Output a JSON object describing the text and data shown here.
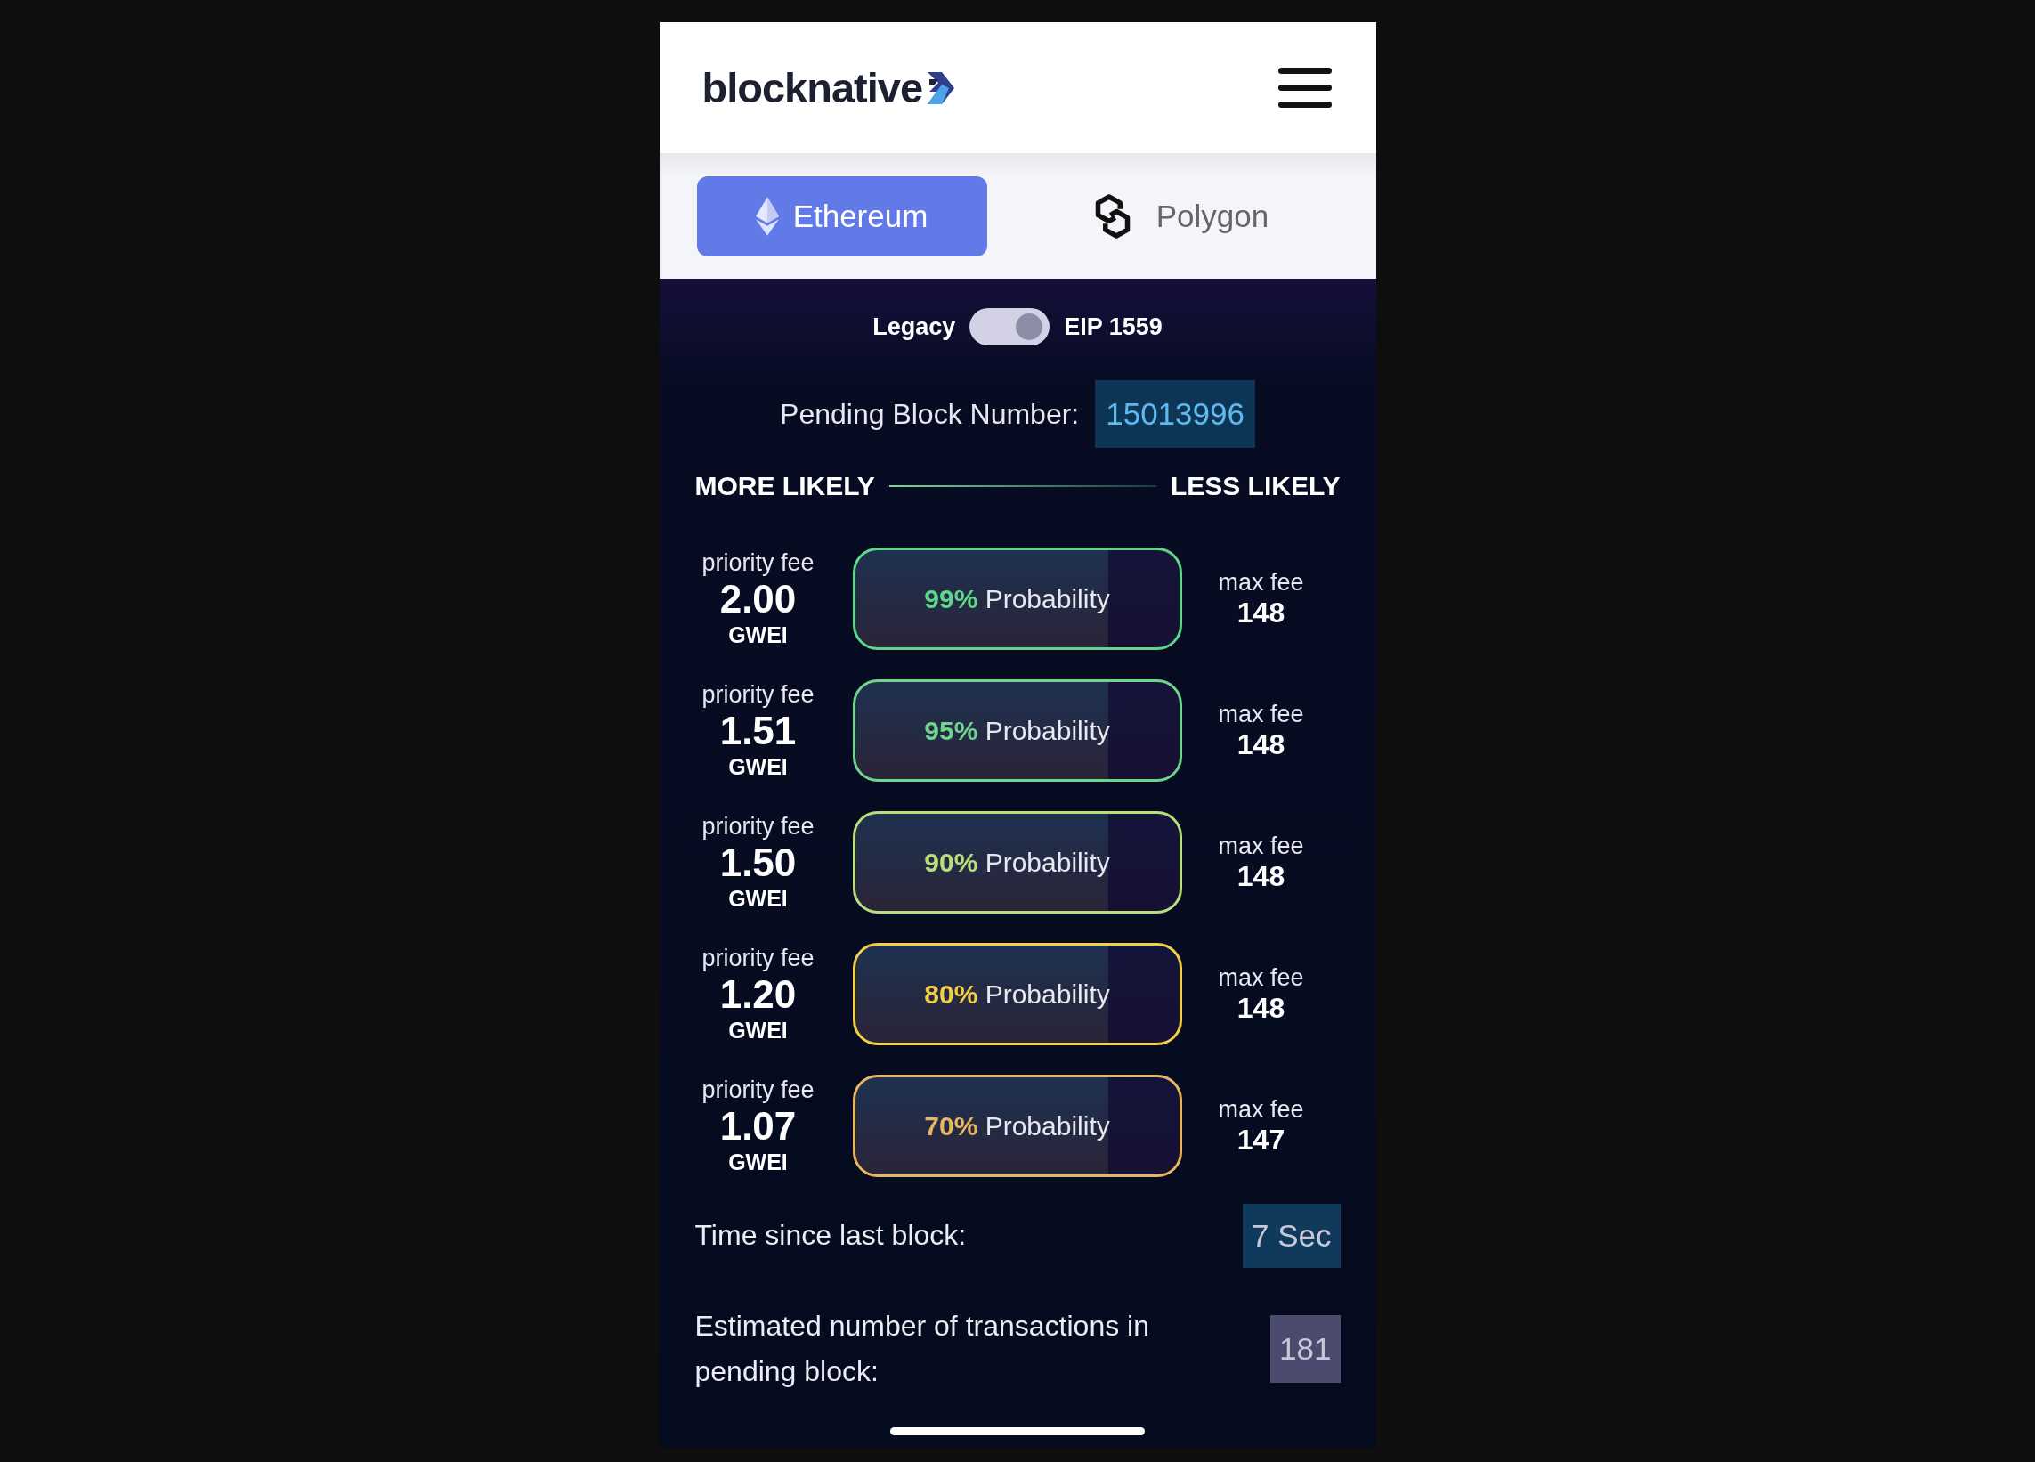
{
  "header": {
    "logo": "blocknative"
  },
  "network_tabs": [
    {
      "label": "Ethereum",
      "kind": "ethereum",
      "selected": true
    },
    {
      "label": "Polygon",
      "kind": "polygon",
      "selected": false
    }
  ],
  "fee_toggle": {
    "left_label": "Legacy",
    "right_label": "EIP 1559",
    "on": true
  },
  "pending_block": {
    "label": "Pending Block Number:",
    "value": "15013996"
  },
  "likelihood_scale": {
    "start": "MORE LIKELY",
    "end": "LESS LIKELY"
  },
  "estimates": [
    {
      "priority_label": "priority fee",
      "priority_value": "2.00",
      "unit": "GWEI",
      "probability": "99%",
      "probability_label": "Probability",
      "color": "#5fd68a",
      "max_fee_label": "max fee",
      "max_fee": "148"
    },
    {
      "priority_label": "priority fee",
      "priority_value": "1.51",
      "unit": "GWEI",
      "probability": "95%",
      "probability_label": "Probability",
      "color": "#6fd48c",
      "max_fee_label": "max fee",
      "max_fee": "148"
    },
    {
      "priority_label": "priority fee",
      "priority_value": "1.50",
      "unit": "GWEI",
      "probability": "90%",
      "probability_label": "Probability",
      "color": "#b8e07a",
      "max_fee_label": "max fee",
      "max_fee": "148"
    },
    {
      "priority_label": "priority fee",
      "priority_value": "1.20",
      "unit": "GWEI",
      "probability": "80%",
      "probability_label": "Probability",
      "color": "#f2cf45",
      "max_fee_label": "max fee",
      "max_fee": "148"
    },
    {
      "priority_label": "priority fee",
      "priority_value": "1.07",
      "unit": "GWEI",
      "probability": "70%",
      "probability_label": "Probability",
      "color": "#e9b660",
      "max_fee_label": "max fee",
      "max_fee": "147"
    }
  ],
  "stats": [
    {
      "kind": "time",
      "label": "Time since last block:",
      "value": "7 Sec"
    },
    {
      "kind": "count",
      "label": "Estimated number of transactions in pending block:",
      "value": "181"
    }
  ]
}
